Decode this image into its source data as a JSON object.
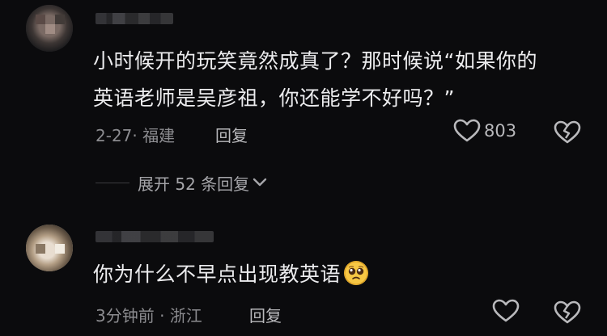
{
  "comments": [
    {
      "text_line1": "小时候开的玩笑竟然成真了？那时候说“如果你的",
      "text_line2": "英语老师是吴彦祖，你还能学不好吗？”",
      "meta": "2-27· 福建",
      "reply_label": "回复",
      "like_count": "803"
    },
    {
      "text": "你为什么不早点出现教英语",
      "emoji": "pleading-face-emoji",
      "meta": "3分钟前 · 浙江",
      "reply_label": "回复",
      "like_count": ""
    }
  ],
  "expand_replies_label": "展开 52 条回复",
  "icons": [
    "heart-outline-icon",
    "broken-heart-icon",
    "chevron-down-icon"
  ],
  "colors": {
    "background": "#0b0b0d",
    "text": "#ececee",
    "meta": "#8c8c90"
  }
}
